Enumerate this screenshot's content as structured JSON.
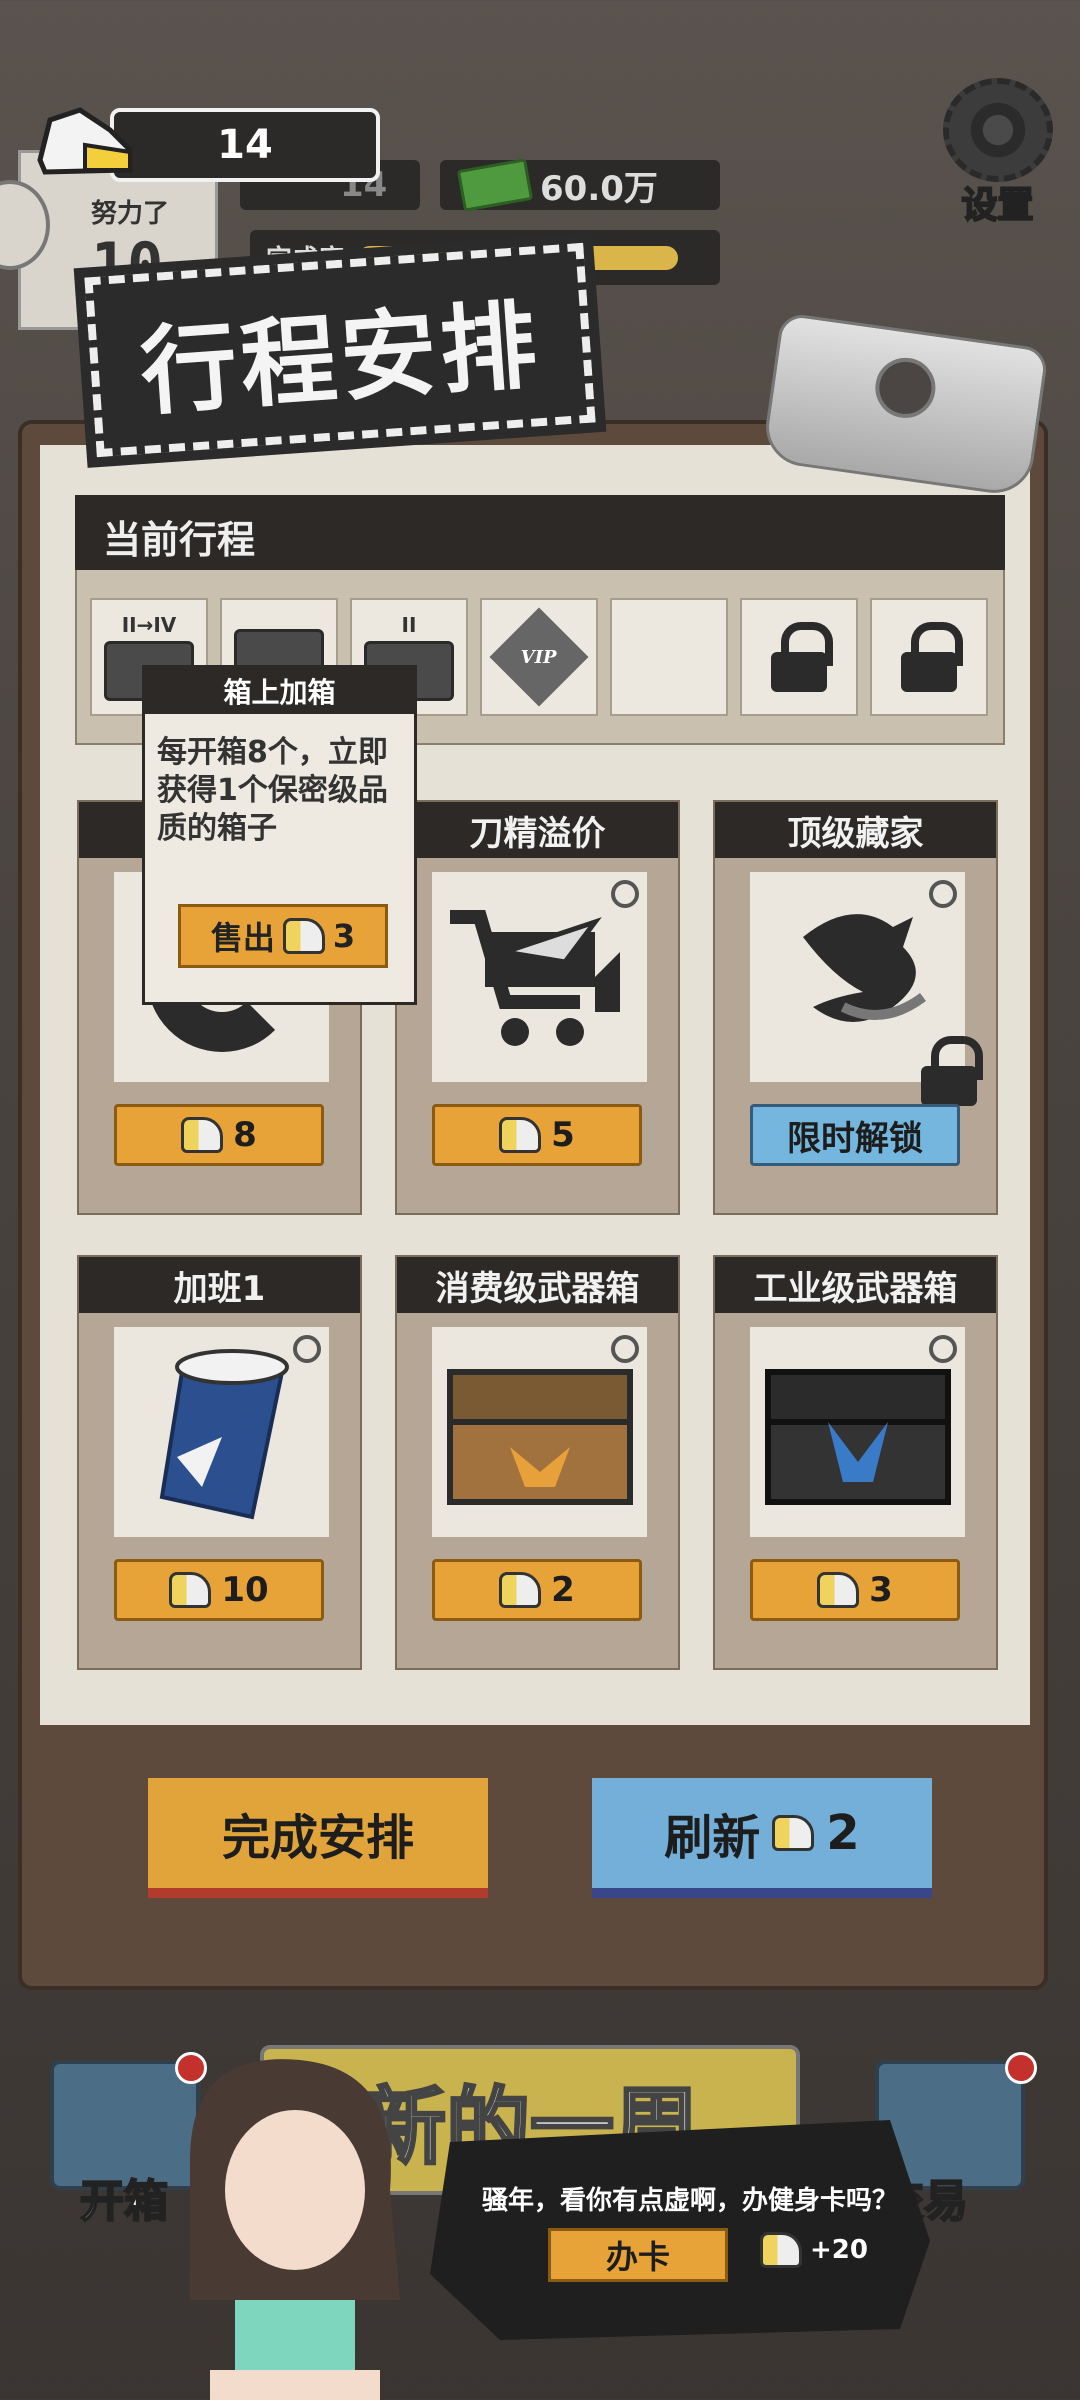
{
  "hud": {
    "shoe_count": "14",
    "shoe_count_small": "14",
    "money": "60.0万",
    "effort_label": "努力了",
    "effort_value": "10",
    "completion_label": "完成度",
    "completion_value": "100%",
    "completion_fraction": 1.0,
    "settings_label": "设置"
  },
  "title": "行程安排",
  "current": {
    "header": "当前行程",
    "slots": [
      {
        "label": "II→IV",
        "icon": "crate-icon"
      },
      {
        "label": "",
        "icon": "crate-icon"
      },
      {
        "label": "II",
        "icon": "crate-icon"
      },
      {
        "label": "VIP",
        "icon": "vip-upgrade-icon"
      },
      {
        "label": "",
        "icon": "empty"
      },
      {
        "label": "",
        "icon": "lock-icon"
      },
      {
        "label": "",
        "icon": "lock-icon"
      }
    ]
  },
  "tooltip": {
    "title": "箱上加箱",
    "body": "每开箱8个，立即获得1个保密级品质的箱子",
    "sell_label": "售出",
    "sell_price": "3"
  },
  "cards": [
    {
      "title": "",
      "price": "8",
      "icon": "ring-icon"
    },
    {
      "title": "刀精溢价",
      "price": "5",
      "icon": "cart-knife-icon"
    },
    {
      "title": "顶级藏家",
      "price": "限时解锁",
      "icon": "dragon-icon",
      "locked": true
    },
    {
      "title": "加班1",
      "price": "10",
      "icon": "coffee-cup-icon"
    },
    {
      "title": "消费级武器箱",
      "price": "2",
      "icon": "wood-crate-icon"
    },
    {
      "title": "工业级武器箱",
      "price": "3",
      "icon": "black-crate-icon"
    }
  ],
  "buttons": {
    "finish": "完成安排",
    "refresh": "刷新",
    "refresh_cost": "2"
  },
  "scene": {
    "week_banner": "新的一周",
    "left_side": "开箱",
    "right_side": "交易",
    "speech": "骚年，看你有点虚啊，办健身卡吗？",
    "card_button": "办卡",
    "reward": "+20"
  },
  "colors": {
    "accent_orange": "#e7a338",
    "accent_blue": "#74b6de",
    "dark_header": "#2c2926"
  }
}
